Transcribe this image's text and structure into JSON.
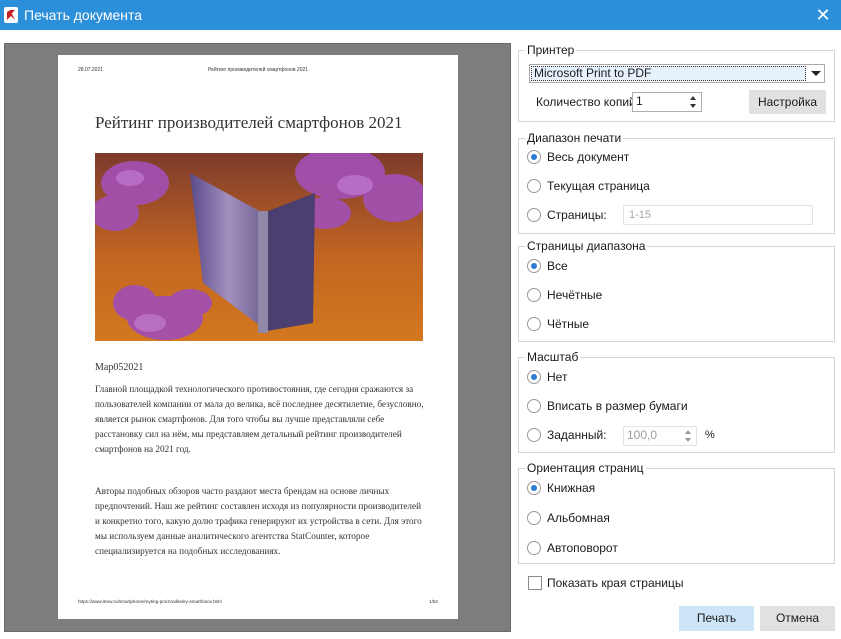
{
  "window": {
    "title": "Печать документа",
    "close_glyph": "✕",
    "icons": {
      "app": "app-logo-icon",
      "close": "close-icon"
    }
  },
  "preview": {
    "header_date": "28.07.2021",
    "header_title": "Рейтинг производителей смартфонов 2021",
    "heading": "Рейтинг производителей смартфонов 2021",
    "image_description": "",
    "date_line": "Мар052021",
    "paragraph_1": "Главной площадкой технологического противостояния, где сегодня сражаются за пользователей компании от мала до велика, всё последнее десятилетие, безусловно, является рынок смартфонов. Для того чтобы вы лучше представляли себе расстановку сил на нём, мы представляем детальный рейтинг производителей смартфонов на 2021 год.",
    "paragraph_2": "Авторы подобных обзоров часто раздают места брендам на основе личных предпочтений. Наш же рейтинг составлен исходя из популярности производителей и конкретно того, какую долю трафика генерируют их устройства в сети. Для этого мы используем данные аналитического агентства StatCounter, которое специализируется на подобных исследованиях.",
    "footer_url": "https://www.itrew.ru/smartphone/reyting-proizvoditeley-smartfonov.html",
    "footer_page": "1/52"
  },
  "printer": {
    "group_title": "Принтер",
    "selected_printer": "Microsoft Print to PDF",
    "copies_label": "Количество копий",
    "copies_value": "1",
    "settings_button": "Настройка"
  },
  "print_range": {
    "group_title": "Диапазон печати",
    "options": [
      "Весь документ",
      "Текущая страница",
      "Страницы:"
    ],
    "selected": 0,
    "pages_placeholder": "1-15"
  },
  "range_pages": {
    "group_title": "Страницы диапазона",
    "options": [
      "Все",
      "Нечётные",
      "Чётные"
    ],
    "selected": 0
  },
  "scale": {
    "group_title": "Масштаб",
    "options": [
      "Нет",
      "Вписать в размер бумаги",
      "Заданный:"
    ],
    "selected": 0,
    "custom_value": "100,0",
    "unit": "%"
  },
  "orientation": {
    "group_title": "Ориентация страниц",
    "options": [
      "Книжная",
      "Альбомная",
      "Автоповорот"
    ],
    "selected": 0
  },
  "show_page_edges": {
    "label": "Показать края страницы",
    "checked": false
  },
  "buttons": {
    "print": "Печать",
    "cancel": "Отмена"
  },
  "colors": {
    "titlebar": "#2b8fd9",
    "accent": "#2b7cd3",
    "primary_button": "#cde6f7",
    "preview_background": "#7d7d7d"
  }
}
